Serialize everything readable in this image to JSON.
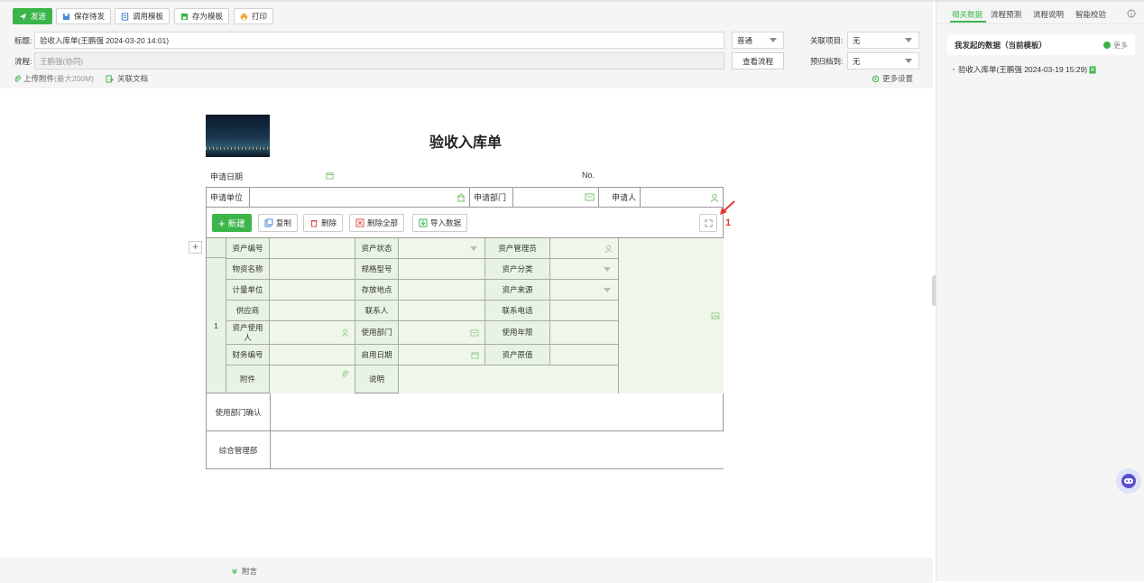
{
  "toolbar": {
    "send": "发送",
    "save_pending": "保存待发",
    "call_template": "调用模板",
    "save_template": "存为模板",
    "print": "打印"
  },
  "form_header": {
    "title_label": "标题:",
    "title_value": "验收入库单(王鹏强 2024-03-20 14:01)",
    "flow_label": "流程:",
    "flow_value": "王鹏强(协同)",
    "priority_value": "普通",
    "related_project_label": "关联项目:",
    "related_project_value": "无",
    "view_flow": "查看流程",
    "archive_label": "预归档到:",
    "archive_value": "无",
    "upload": "上传附件",
    "upload_hint": "(最大200M)",
    "related_doc": "关联文档",
    "more_settings": "更多设置"
  },
  "document": {
    "title": "验收入库单",
    "apply_date_label": "申请日期",
    "no_label": "No.",
    "unit_label": "申请单位",
    "dept_label": "申请部门",
    "applicant_label": "申请人",
    "annotation": "1"
  },
  "subtable": {
    "new": "新建",
    "copy": "复制",
    "delete": "删除",
    "delete_all": "删除全部",
    "import": "导入数据",
    "row_no": "1",
    "add": "+",
    "fields": {
      "asset_no": "资产编号",
      "asset_status": "资产状态",
      "asset_admin": "资产管理员",
      "material_name": "物资名称",
      "spec": "规格型号",
      "asset_category": "资产分类",
      "unit": "计量单位",
      "location": "存放地点",
      "asset_source": "资产来源",
      "supplier": "供应商",
      "contact": "联系人",
      "phone": "联系电话",
      "asset_user": "资产使用人",
      "use_dept": "使用部门",
      "life": "使用年限",
      "finance_no": "财务编号",
      "start_date": "启用日期",
      "original_value": "资产原值",
      "attachment": "附件",
      "remark": "说明"
    }
  },
  "footer_rows": {
    "dept_confirm": "使用部门确认",
    "general_dept": "综合管理部"
  },
  "bottom": {
    "appendix": "附言"
  },
  "right_panel": {
    "tabs": [
      "相关数据",
      "流程预测",
      "流程说明",
      "智能校验"
    ],
    "card_title": "我发起的数据（当前模板）",
    "more": "更多",
    "item": "验收入库单(王鹏强 2024-03-19 15:29)"
  },
  "colors": {
    "brand_green": "#3bb54a",
    "annotation_red": "#e53935"
  }
}
